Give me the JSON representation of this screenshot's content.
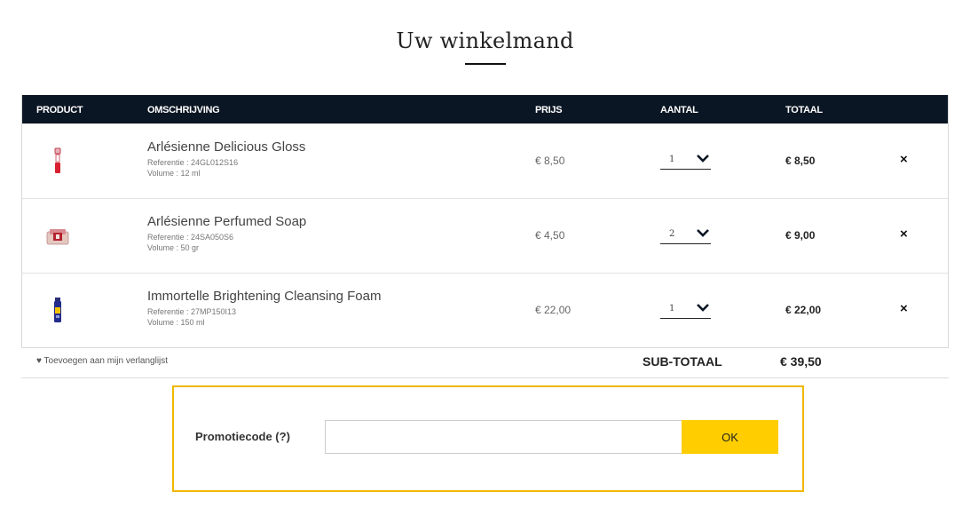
{
  "page": {
    "title": "Uw winkelmand"
  },
  "table": {
    "headers": {
      "product": "PRODUCT",
      "description": "OMSCHRIJVING",
      "price": "PRIJS",
      "quantity": "AANTAL",
      "total": "TOTAAL"
    },
    "remove_glyph": "×",
    "items": [
      {
        "name": "Arlésienne Delicious Gloss",
        "reference": "Referentie : 24GL012S16",
        "volume": "Volume : 12 ml",
        "price": "€ 8,50",
        "quantity": "1",
        "total": "€ 8,50",
        "thumb_icon": "lipgloss-tube-icon"
      },
      {
        "name": "Arlésienne Perfumed Soap",
        "reference": "Referentie : 24SA050S6",
        "volume": "Volume : 50 gr",
        "price": "€ 4,50",
        "quantity": "2",
        "total": "€ 9,00",
        "thumb_icon": "soap-bar-icon"
      },
      {
        "name": "Immortelle Brightening Cleansing Foam",
        "reference": "Referentie : 27MP150I13",
        "volume": "Volume : 150 ml",
        "price": "€ 22,00",
        "quantity": "1",
        "total": "€ 22,00",
        "thumb_icon": "foam-bottle-icon"
      }
    ]
  },
  "wishlist": {
    "label": "♥ Toevoegen aan mijn verlanglijst"
  },
  "subtotal": {
    "label": "SUB-TOTAAL",
    "value": "€ 39,50"
  },
  "promo": {
    "label": "Promotiecode (?)",
    "value": "",
    "placeholder": "",
    "button_label": "OK"
  },
  "colors": {
    "header_bg": "#0b1624",
    "accent_yellow": "#ffcd00",
    "promo_border": "#f0b800"
  }
}
